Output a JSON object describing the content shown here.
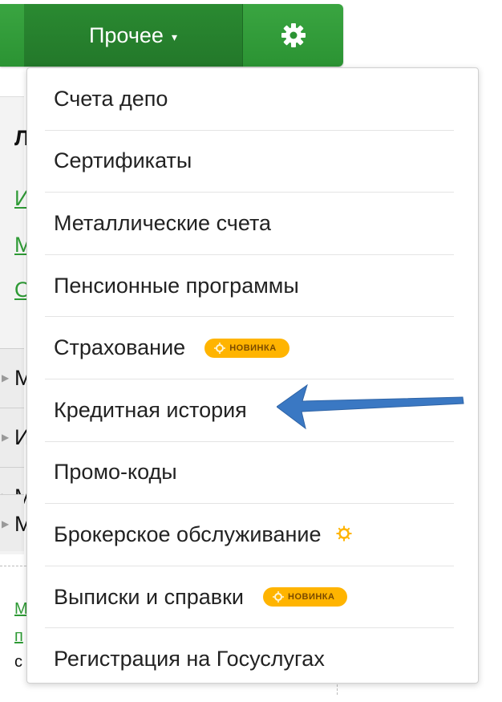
{
  "nav": {
    "other_label": "Прочее",
    "caret": "▾",
    "settings_icon": "gear-icon"
  },
  "menu": {
    "items": [
      {
        "label": "Счета депо"
      },
      {
        "label": "Сертификаты"
      },
      {
        "label": "Металлические счета"
      },
      {
        "label": "Пенсионные программы"
      },
      {
        "label": "Страхование",
        "badge": "НОВИНКА"
      },
      {
        "label": "Кредитная история"
      },
      {
        "label": "Промо-коды"
      },
      {
        "label": "Брокерское обслуживание"
      },
      {
        "label": "Выписки и справки",
        "badge": "НОВИНКА"
      },
      {
        "label": "Регистрация на Госуслугах"
      }
    ]
  },
  "background": {
    "heading_letter": "Л",
    "link_letters": [
      "И",
      "М",
      "О"
    ],
    "row_letters": [
      "М",
      "И",
      "М",
      "М"
    ],
    "bottom_letters": [
      "М",
      "п",
      "с"
    ]
  },
  "colors": {
    "nav_green": "#2b9333",
    "nav_active": "#23782a",
    "badge": "#ffb400",
    "arrow": "#3a78c3"
  }
}
